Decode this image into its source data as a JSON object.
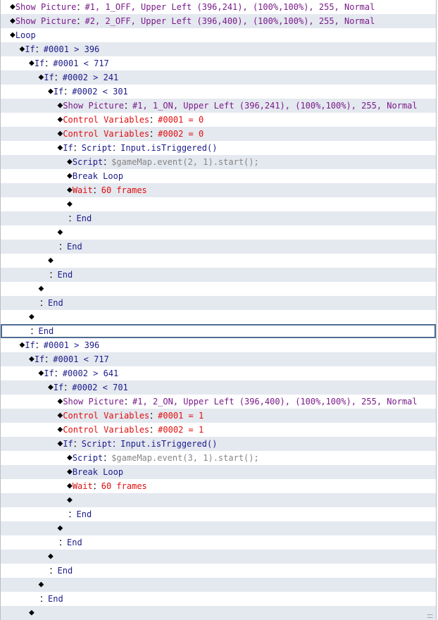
{
  "editor": {
    "rows": [
      {
        "indent": 0,
        "kind": "pic",
        "label": "Show Picture",
        "args": "#1, 1_OFF, Upper Left (396,241), (100%,100%), 255, Normal"
      },
      {
        "indent": 0,
        "kind": "pic",
        "label": "Show Picture",
        "args": "#2, 2_OFF, Upper Left (396,400), (100%,100%), 255, Normal"
      },
      {
        "indent": 0,
        "kind": "loop",
        "label": "Loop",
        "args": ""
      },
      {
        "indent": 1,
        "kind": "if",
        "label": "If",
        "args": "#0001 > 396"
      },
      {
        "indent": 2,
        "kind": "if",
        "label": "If",
        "args": "#0001 < 717"
      },
      {
        "indent": 3,
        "kind": "if",
        "label": "If",
        "args": "#0002 > 241"
      },
      {
        "indent": 4,
        "kind": "if",
        "label": "If",
        "args": "#0002 < 301"
      },
      {
        "indent": 5,
        "kind": "pic",
        "label": "Show Picture",
        "args": "#1, 1_ON, Upper Left (396,241), (100%,100%), 255, Normal"
      },
      {
        "indent": 5,
        "kind": "var",
        "label": "Control Variables",
        "args": "#0001 = 0"
      },
      {
        "indent": 5,
        "kind": "var",
        "label": "Control Variables",
        "args": "#0002 = 0"
      },
      {
        "indent": 5,
        "kind": "if",
        "label": "If",
        "args": "Script：Input.isTriggered()"
      },
      {
        "indent": 6,
        "kind": "script",
        "label": "Script",
        "args": "$gameMap.event(2, 1).start();"
      },
      {
        "indent": 6,
        "kind": "break",
        "label": "Break Loop",
        "args": ""
      },
      {
        "indent": 6,
        "kind": "wait",
        "label": "Wait",
        "args": "60 frames"
      },
      {
        "indent": 6,
        "kind": "empty",
        "label": "",
        "args": ""
      },
      {
        "indent": 5,
        "kind": "end",
        "label": "End",
        "args": ""
      },
      {
        "indent": 5,
        "kind": "empty",
        "label": "",
        "args": ""
      },
      {
        "indent": 4,
        "kind": "end",
        "label": "End",
        "args": ""
      },
      {
        "indent": 4,
        "kind": "empty",
        "label": "",
        "args": ""
      },
      {
        "indent": 3,
        "kind": "end",
        "label": "End",
        "args": ""
      },
      {
        "indent": 3,
        "kind": "empty",
        "label": "",
        "args": ""
      },
      {
        "indent": 2,
        "kind": "end",
        "label": "End",
        "args": ""
      },
      {
        "indent": 2,
        "kind": "empty",
        "label": "",
        "args": ""
      },
      {
        "indent": 1,
        "kind": "end",
        "label": "End",
        "args": "",
        "selected": true
      },
      {
        "indent": 1,
        "kind": "if",
        "label": "If",
        "args": "#0001 > 396"
      },
      {
        "indent": 2,
        "kind": "if",
        "label": "If",
        "args": "#0001 < 717"
      },
      {
        "indent": 3,
        "kind": "if",
        "label": "If",
        "args": "#0002 > 641"
      },
      {
        "indent": 4,
        "kind": "if",
        "label": "If",
        "args": "#0002 < 701"
      },
      {
        "indent": 5,
        "kind": "pic",
        "label": "Show Picture",
        "args": "#1, 2_ON, Upper Left (396,400), (100%,100%), 255, Normal"
      },
      {
        "indent": 5,
        "kind": "var",
        "label": "Control Variables",
        "args": "#0001 = 1"
      },
      {
        "indent": 5,
        "kind": "var",
        "label": "Control Variables",
        "args": "#0002 = 1"
      },
      {
        "indent": 5,
        "kind": "if",
        "label": "If",
        "args": "Script：Input.isTriggered()"
      },
      {
        "indent": 6,
        "kind": "script",
        "label": "Script",
        "args": "$gameMap.event(3, 1).start();"
      },
      {
        "indent": 6,
        "kind": "break",
        "label": "Break Loop",
        "args": ""
      },
      {
        "indent": 6,
        "kind": "wait",
        "label": "Wait",
        "args": "60 frames"
      },
      {
        "indent": 6,
        "kind": "empty",
        "label": "",
        "args": ""
      },
      {
        "indent": 5,
        "kind": "end",
        "label": "End",
        "args": ""
      },
      {
        "indent": 5,
        "kind": "empty",
        "label": "",
        "args": ""
      },
      {
        "indent": 4,
        "kind": "end",
        "label": "End",
        "args": ""
      },
      {
        "indent": 4,
        "kind": "empty",
        "label": "",
        "args": ""
      },
      {
        "indent": 3,
        "kind": "end",
        "label": "End",
        "args": ""
      },
      {
        "indent": 3,
        "kind": "empty",
        "label": "",
        "args": ""
      },
      {
        "indent": 2,
        "kind": "end",
        "label": "End",
        "args": ""
      },
      {
        "indent": 2,
        "kind": "empty",
        "label": "",
        "args": ""
      }
    ]
  },
  "glyphs": {
    "bullet": "◆",
    "separator": "："
  }
}
